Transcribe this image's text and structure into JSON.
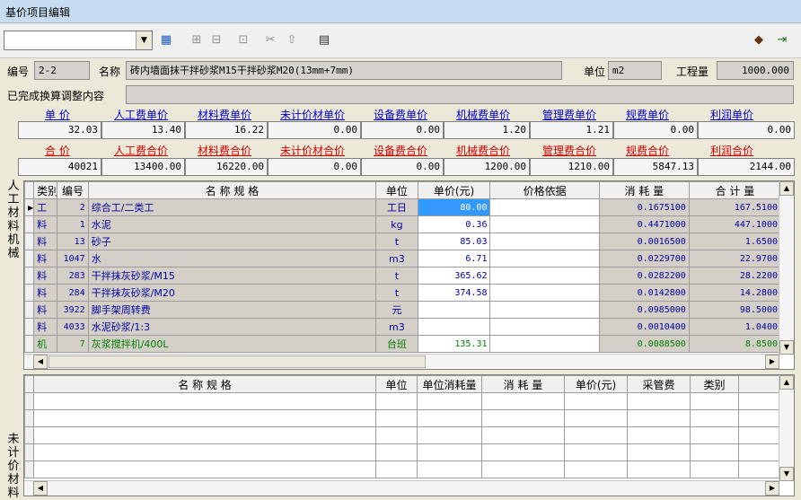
{
  "window": {
    "title": "基价项目编辑"
  },
  "toolbar": {
    "combo_value": ""
  },
  "item": {
    "code_label": "编号",
    "code": "2-2",
    "name_label": "名称",
    "name": "砖内墙面抹干拌砂浆M15干拌砂浆M20(13mm+7mm)",
    "unit_label": "单位",
    "unit": "m2",
    "qty_label": "工程量",
    "qty": "1000.000",
    "adjust_label": "已完成换算调整内容",
    "adjust": ""
  },
  "unit_prices": {
    "labels": [
      "单  价",
      "人工费单价",
      "材料费单价",
      "未计价材单价",
      "设备费单价",
      "机械费单价",
      "管理费单价",
      "规费单价",
      "利润单价"
    ],
    "values": [
      "32.03",
      "13.40",
      "16.22",
      "0.00",
      "0.00",
      "1.20",
      "1.21",
      "0.00",
      "0.00"
    ]
  },
  "total_prices": {
    "labels": [
      "合  价",
      "人工费合价",
      "材料费合价",
      "未计价材合价",
      "设备费合价",
      "机械费合价",
      "管理费合价",
      "规费合价",
      "利润合价"
    ],
    "values": [
      "40021",
      "13400.00",
      "16220.00",
      "0.00",
      "0.00",
      "1200.00",
      "1210.00",
      "5847.13",
      "2144.00"
    ]
  },
  "side_labels": {
    "top": "人工材料机械",
    "bottom": "未计价材料"
  },
  "main_table": {
    "headers": [
      "类别",
      "编号",
      "名    称    规    格",
      "单位",
      "单价(元)",
      "价格依据",
      "消 耗 量",
      "合 计 量"
    ],
    "rows": [
      {
        "type": "工",
        "code": "2",
        "name": "综合工/二类工",
        "unit": "工日",
        "price": "80.00",
        "basis": "",
        "consume": "0.1675100",
        "total": "167.5100"
      },
      {
        "type": "料",
        "code": "1",
        "name": "水泥",
        "unit": "kg",
        "price": "0.36",
        "basis": "",
        "consume": "0.4471000",
        "total": "447.1000"
      },
      {
        "type": "料",
        "code": "13",
        "name": "砂子",
        "unit": "t",
        "price": "85.03",
        "basis": "",
        "consume": "0.0016500",
        "total": "1.6500"
      },
      {
        "type": "料",
        "code": "1047",
        "name": "水",
        "unit": "m3",
        "price": "6.71",
        "basis": "",
        "consume": "0.0229700",
        "total": "22.9700"
      },
      {
        "type": "料",
        "code": "283",
        "name": "干拌抹灰砂浆/M15",
        "unit": "t",
        "price": "365.62",
        "basis": "",
        "consume": "0.0282200",
        "total": "28.2200"
      },
      {
        "type": "料",
        "code": "284",
        "name": "干拌抹灰砂浆/M20",
        "unit": "t",
        "price": "374.58",
        "basis": "",
        "consume": "0.0142800",
        "total": "14.2800"
      },
      {
        "type": "料",
        "code": "3922",
        "name": "脚手架周转费",
        "unit": "元",
        "price": "",
        "basis": "",
        "consume": "0.0985000",
        "total": "98.5000"
      },
      {
        "type": "料",
        "code": "4033",
        "name": "水泥砂浆/1:3",
        "unit": "m3",
        "price": "",
        "basis": "",
        "consume": "0.0010400",
        "total": "1.0400"
      },
      {
        "type": "机",
        "code": "7",
        "name": "灰浆搅拌机/400L",
        "unit": "台班",
        "price": "135.31",
        "basis": "",
        "consume": "0.0088500",
        "total": "8.8500"
      }
    ]
  },
  "sub_table": {
    "headers": [
      "名    称    规    格",
      "单位",
      "单位消耗量",
      "消 耗 量",
      "单价(元)",
      "采管费",
      "类别"
    ]
  },
  "colors": {
    "accent": "#0000C8",
    "total_label": "#D00000",
    "selection": "#3399FF"
  }
}
